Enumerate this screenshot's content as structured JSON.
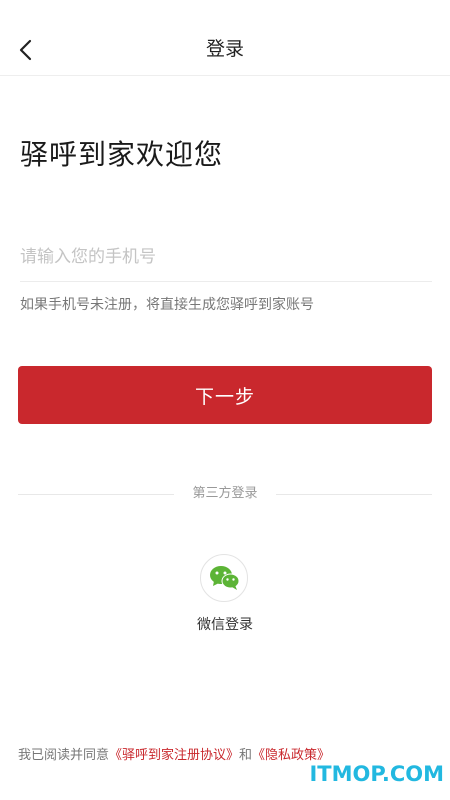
{
  "nav": {
    "back_icon": "chevron-left-icon",
    "title": "登录"
  },
  "welcome": {
    "heading": "驿呼到家欢迎您"
  },
  "phone": {
    "placeholder": "请输入您的手机号",
    "value": ""
  },
  "hint": "如果手机号未注册，将直接生成您驿呼到家账号",
  "next_button": {
    "label": "下一步"
  },
  "third_party": {
    "label": "第三方登录",
    "wechat": {
      "icon": "wechat-icon",
      "label": "微信登录"
    }
  },
  "agreement": {
    "prefix": "我已阅读并同意",
    "terms_link": "《驿呼到家注册协议》",
    "conjunction": "和",
    "privacy_link": "《隐私政策》"
  },
  "watermark": "ITMOP.COM",
  "colors": {
    "brand_red": "#c9282d",
    "wechat_green": "#5cb436",
    "watermark_blue": "#22b8e0"
  }
}
